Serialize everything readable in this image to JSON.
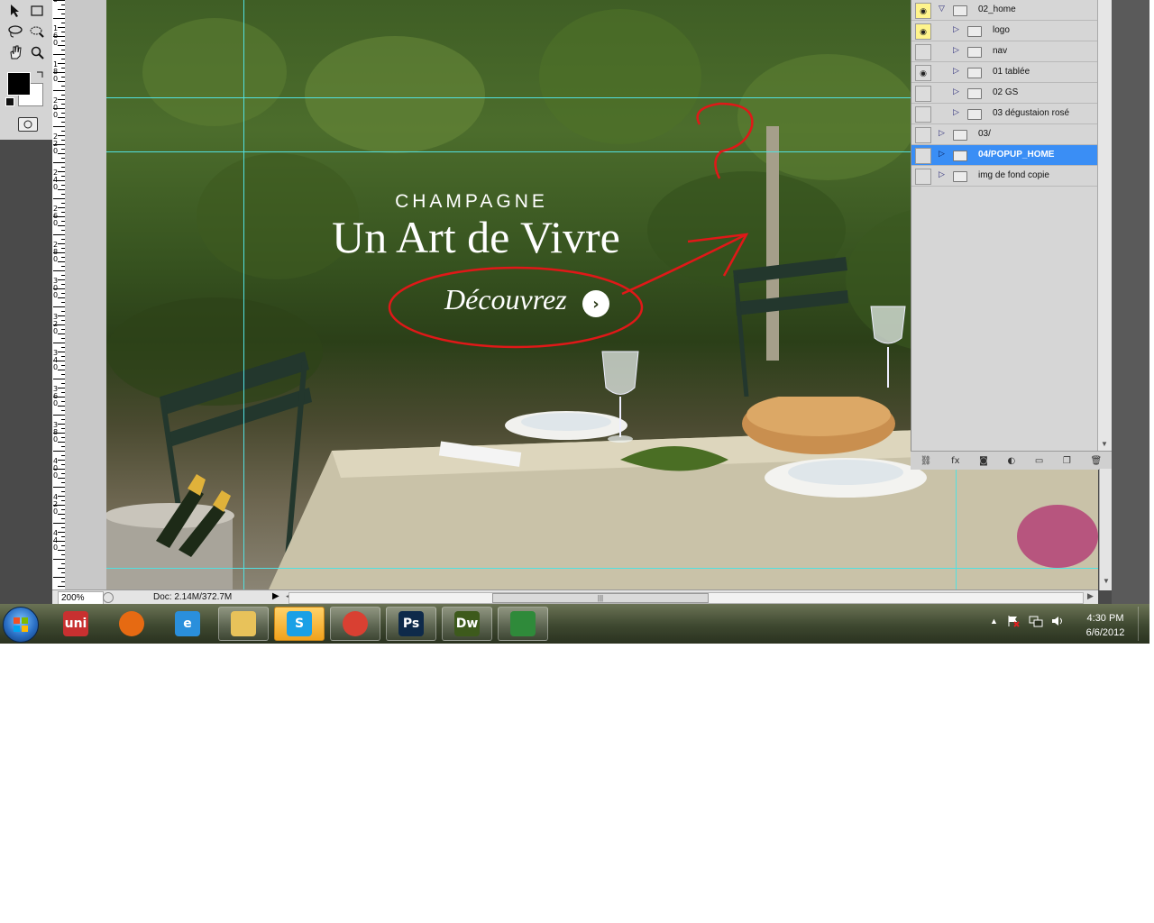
{
  "window": {
    "app": "Adobe Photoshop",
    "zoom": "200%",
    "doc_info": "Doc: 2.14M/372.7M"
  },
  "ruler": {
    "labels": [
      "4\n0",
      "1\n6\n0",
      "1\n8\n0",
      "2\n0\n0",
      "2\n2\n0",
      "2\n4\n0",
      "2\n6\n0",
      "2\n8\n0",
      "3\n0\n0",
      "3\n2\n0",
      "3\n4\n0",
      "3\n6\n0",
      "3\n8\n0",
      "4\n0\n0",
      "4\n2\n0",
      "4\n4\n0"
    ]
  },
  "canvas": {
    "brand": "CHAMPAGNE",
    "headline": "Un Art de Vivre",
    "cta": "Découvrez",
    "cta_arrow": "›",
    "annotation_color": "#e01818",
    "guide_color": "#52e0e0"
  },
  "layers": {
    "rows": [
      {
        "name": "02_home",
        "eye": true,
        "eye_yellow": true,
        "expanded": true,
        "indent": 0,
        "selected": false
      },
      {
        "name": "logo",
        "eye": true,
        "eye_yellow": true,
        "expanded": false,
        "indent": 1,
        "selected": false
      },
      {
        "name": "nav",
        "eye": false,
        "eye_yellow": false,
        "expanded": false,
        "indent": 1,
        "selected": false
      },
      {
        "name": "01 tablée",
        "eye": true,
        "eye_yellow": false,
        "expanded": false,
        "indent": 1,
        "selected": false
      },
      {
        "name": "02 GS",
        "eye": false,
        "eye_yellow": false,
        "expanded": false,
        "indent": 1,
        "selected": false
      },
      {
        "name": "03 dégustaion rosé",
        "eye": false,
        "eye_yellow": false,
        "expanded": false,
        "indent": 1,
        "selected": false
      },
      {
        "name": "03/",
        "eye": false,
        "eye_yellow": false,
        "expanded": false,
        "indent": 0,
        "selected": false
      },
      {
        "name": "04/POPUP_HOME",
        "eye": false,
        "eye_yellow": false,
        "expanded": false,
        "indent": 0,
        "selected": true
      },
      {
        "name": "img de fond copie",
        "eye": false,
        "eye_yellow": false,
        "expanded": false,
        "indent": 0,
        "selected": false
      }
    ],
    "footer_icons": [
      "link-icon",
      "fx-icon",
      "mask-icon",
      "adjustment-icon",
      "group-icon",
      "new-layer-icon",
      "trash-icon"
    ],
    "footer_fx": "fx"
  },
  "taskbar": {
    "apps": [
      {
        "name": "unikey",
        "glyph": "uni",
        "color": "#c83030",
        "state": "pinned"
      },
      {
        "name": "firefox",
        "glyph": "",
        "color": "#e66a12",
        "state": "pinned"
      },
      {
        "name": "internet-explorer",
        "glyph": "e",
        "color": "#2a8fdc",
        "state": "pinned"
      },
      {
        "name": "windows-explorer",
        "glyph": "",
        "color": "#e8c25a",
        "state": "open"
      },
      {
        "name": "skype",
        "glyph": "S",
        "color": "#1aa0e6",
        "state": "active"
      },
      {
        "name": "chrome",
        "glyph": "",
        "color": "#d94032",
        "state": "open"
      },
      {
        "name": "photoshop",
        "glyph": "Ps",
        "color": "#0e2a4a",
        "state": "open"
      },
      {
        "name": "dreamweaver",
        "glyph": "Dw",
        "color": "#3d5a1c",
        "state": "open"
      },
      {
        "name": "libreoffice-calc",
        "glyph": "",
        "color": "#2f8a3a",
        "state": "open"
      }
    ],
    "time": "4:30 PM",
    "date": "6/6/2012"
  }
}
